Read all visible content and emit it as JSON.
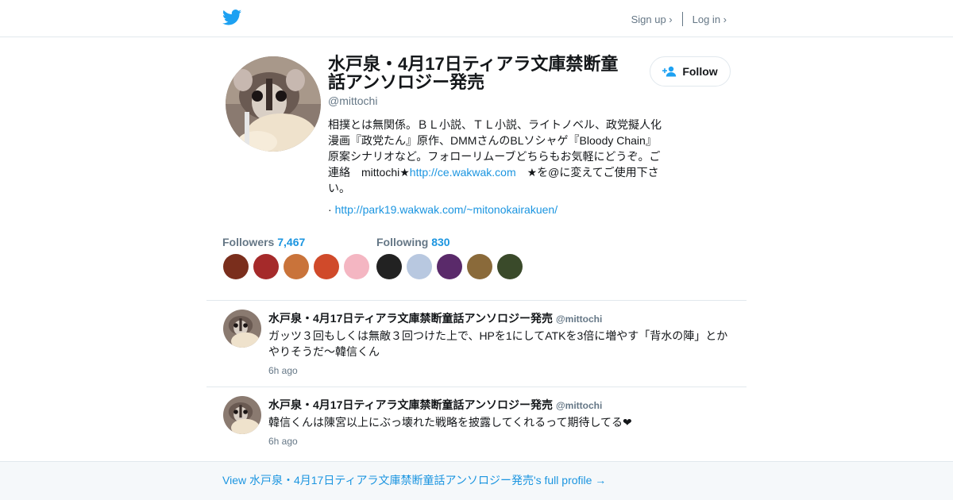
{
  "header": {
    "signup_label": "Sign up ›",
    "login_label": "Log in ›"
  },
  "profile": {
    "name": "水戸泉・4月17日ティアラ文庫禁断童話アンソロジー発売",
    "handle": "@mittochi",
    "bio_part1": "相撲とは無関係。ＢＬ小説、ＴＬ小説、ライトノベル、政党擬人化漫画『政党たん』原作、DMMさんのBLソシャゲ『Bloody Chain』原案シナリオなど。フォローリムーブどちらもお気軽にどうぞ。ご連絡　mittochi★",
    "bio_link": "http://ce.wakwak.com",
    "bio_part2": "　★を@に変えてご使用下さい。",
    "url_prefix": "· ",
    "url": "http://park19.wakwak.com/~mitonokairakuen/",
    "follow_label": "Follow"
  },
  "stats": {
    "followers_label": "Followers",
    "followers_count": "7,467",
    "following_label": "Following",
    "following_count": "830"
  },
  "follower_colors": [
    "#7a2e1c",
    "#a52a2a",
    "#c9733a",
    "#d04a2a",
    "#f4b6c2"
  ],
  "following_colors": [
    "#222222",
    "#b8c8e0",
    "#5a2a6a",
    "#8a6a3a",
    "#3a4a2a"
  ],
  "tweets": [
    {
      "name": "水戸泉・4月17日ティアラ文庫禁断童話アンソロジー発売",
      "handle": "@mittochi",
      "text": "ガッツ３回もしくは無敵３回つけた上で、HPを1にしてATKを3倍に増やす「背水の陣」とかやりそうだ～韓信くん",
      "time": "6h ago"
    },
    {
      "name": "水戸泉・4月17日ティアラ文庫禁断童話アンソロジー発売",
      "handle": "@mittochi",
      "text": "韓信くんは陳宮以上にぶっ壊れた戦略を披露してくれるって期待してる❤",
      "time": "6h ago"
    }
  ],
  "footer": {
    "link_label": "View 水戸泉・4月17日ティアラ文庫禁断童話アンソロジー発売's full profile →"
  },
  "colors": {
    "accent": "#1b95e0",
    "brand": "#1da1f2",
    "muted": "#657786",
    "border": "#e1e8ed"
  }
}
